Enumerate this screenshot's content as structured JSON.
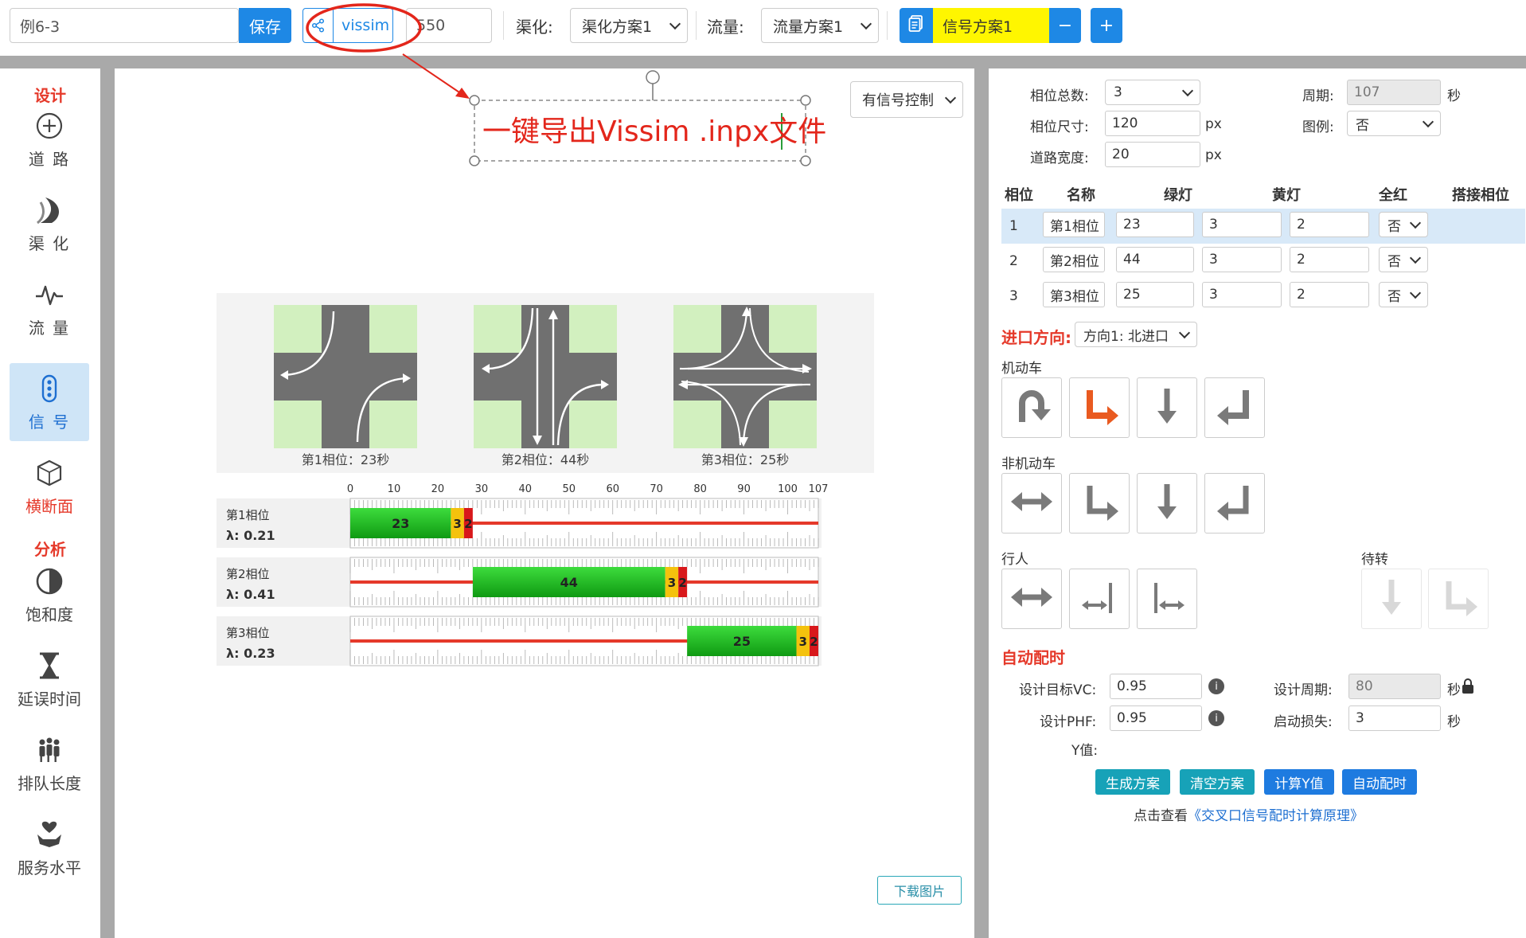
{
  "toolbar": {
    "project_name": "例6-3",
    "save_label": "保存",
    "vissim_label": "vissim",
    "value_550": "550",
    "channel_label": "渠化:",
    "channel_value": "渠化方案1",
    "flow_label": "流量:",
    "flow_value": "流量方案1",
    "signal_value": "信号方案1",
    "minus_label": "−",
    "plus_label": "+"
  },
  "sidebar": {
    "design_heading": "设计",
    "analysis_heading": "分析",
    "items": [
      {
        "label": "道 路",
        "icon": "plus-circle-icon"
      },
      {
        "label": "渠 化",
        "icon": "curve-road-icon"
      },
      {
        "label": "流 量",
        "icon": "pulse-icon"
      },
      {
        "label": "信 号",
        "icon": "traffic-light-icon"
      },
      {
        "label": "横断面",
        "icon": "cube-icon"
      },
      {
        "label": "饱和度",
        "icon": "half-circle-icon"
      },
      {
        "label": "延误时间",
        "icon": "hourglass-icon"
      },
      {
        "label": "排队长度",
        "icon": "people-icon"
      },
      {
        "label": "服务水平",
        "icon": "heart-hand-icon"
      }
    ]
  },
  "canvas": {
    "control_mode": "有信号控制",
    "annotation": "一键导出Vissim .inpx文件",
    "download_label": "下载图片",
    "phase_captions": [
      "第1相位：23秒",
      "第2相位：44秒",
      "第3相位：25秒"
    ],
    "timeline": {
      "ticks": [
        "0",
        "10",
        "20",
        "30",
        "40",
        "50",
        "60",
        "70",
        "80",
        "90",
        "100",
        "107"
      ],
      "rows": [
        {
          "name": "第1相位",
          "lambda": "λ: 0.21",
          "green": "23",
          "yellow": "3",
          "red": "2"
        },
        {
          "name": "第2相位",
          "lambda": "λ: 0.41",
          "green": "44",
          "yellow": "3",
          "red": "2"
        },
        {
          "name": "第3相位",
          "lambda": "λ: 0.23",
          "green": "25",
          "yellow": "3",
          "red": "2"
        }
      ]
    }
  },
  "timing": {
    "cycle": 107,
    "phases": [
      {
        "start": 0,
        "green": 23,
        "yellow": 3,
        "red": 2
      },
      {
        "start": 28,
        "green": 44,
        "yellow": 3,
        "red": 2
      },
      {
        "start": 77,
        "green": 25,
        "yellow": 3,
        "red": 2
      }
    ]
  },
  "panel": {
    "phase_total_label": "相位总数:",
    "phase_total_value": "3",
    "cycle_label": "周期:",
    "cycle_value": "107",
    "cycle_unit": "秒",
    "phase_size_label": "相位尺寸:",
    "phase_size_value": "120",
    "px1": "px",
    "legend_label": "图例:",
    "legend_value": "否",
    "road_width_label": "道路宽度:",
    "road_width_value": "20",
    "px2": "px",
    "headers": [
      "相位",
      "名称",
      "绿灯",
      "黄灯",
      "全红",
      "搭接相位"
    ],
    "rows": [
      {
        "idx": "1",
        "name": "第1相位",
        "green": "23",
        "yellow": "3",
        "red": "2",
        "overlap": "否"
      },
      {
        "idx": "2",
        "name": "第2相位",
        "green": "44",
        "yellow": "3",
        "red": "2",
        "overlap": "否"
      },
      {
        "idx": "3",
        "name": "第3相位",
        "green": "25",
        "yellow": "3",
        "red": "2",
        "overlap": "否"
      }
    ],
    "approach_label": "进口方向:",
    "approach_value": "方向1: 北进口",
    "motor_label": "机动车",
    "nonmotor_label": "非机动车",
    "ped_label": "行人",
    "waiting_label": "待转",
    "auto_heading": "自动配时",
    "target_vc_label": "设计目标VC:",
    "target_vc_value": "0.95",
    "design_cycle_label": "设计周期:",
    "design_cycle_value": "80",
    "design_cycle_unit": "秒",
    "phf_label": "设计PHF:",
    "phf_value": "0.95",
    "startup_label": "启动损失:",
    "startup_value": "3",
    "startup_unit": "秒",
    "y_label": "Y值:",
    "buttons": [
      "生成方案",
      "清空方案",
      "计算Y值",
      "自动配时"
    ],
    "link_prefix": "点击查看",
    "link_text": "《交叉口信号配时计算原理》"
  },
  "colors": {
    "accent": "#1e88e5",
    "red": "#e5392a",
    "green_btn": "#1aa3b0",
    "blue_btn": "#1e7be0"
  }
}
